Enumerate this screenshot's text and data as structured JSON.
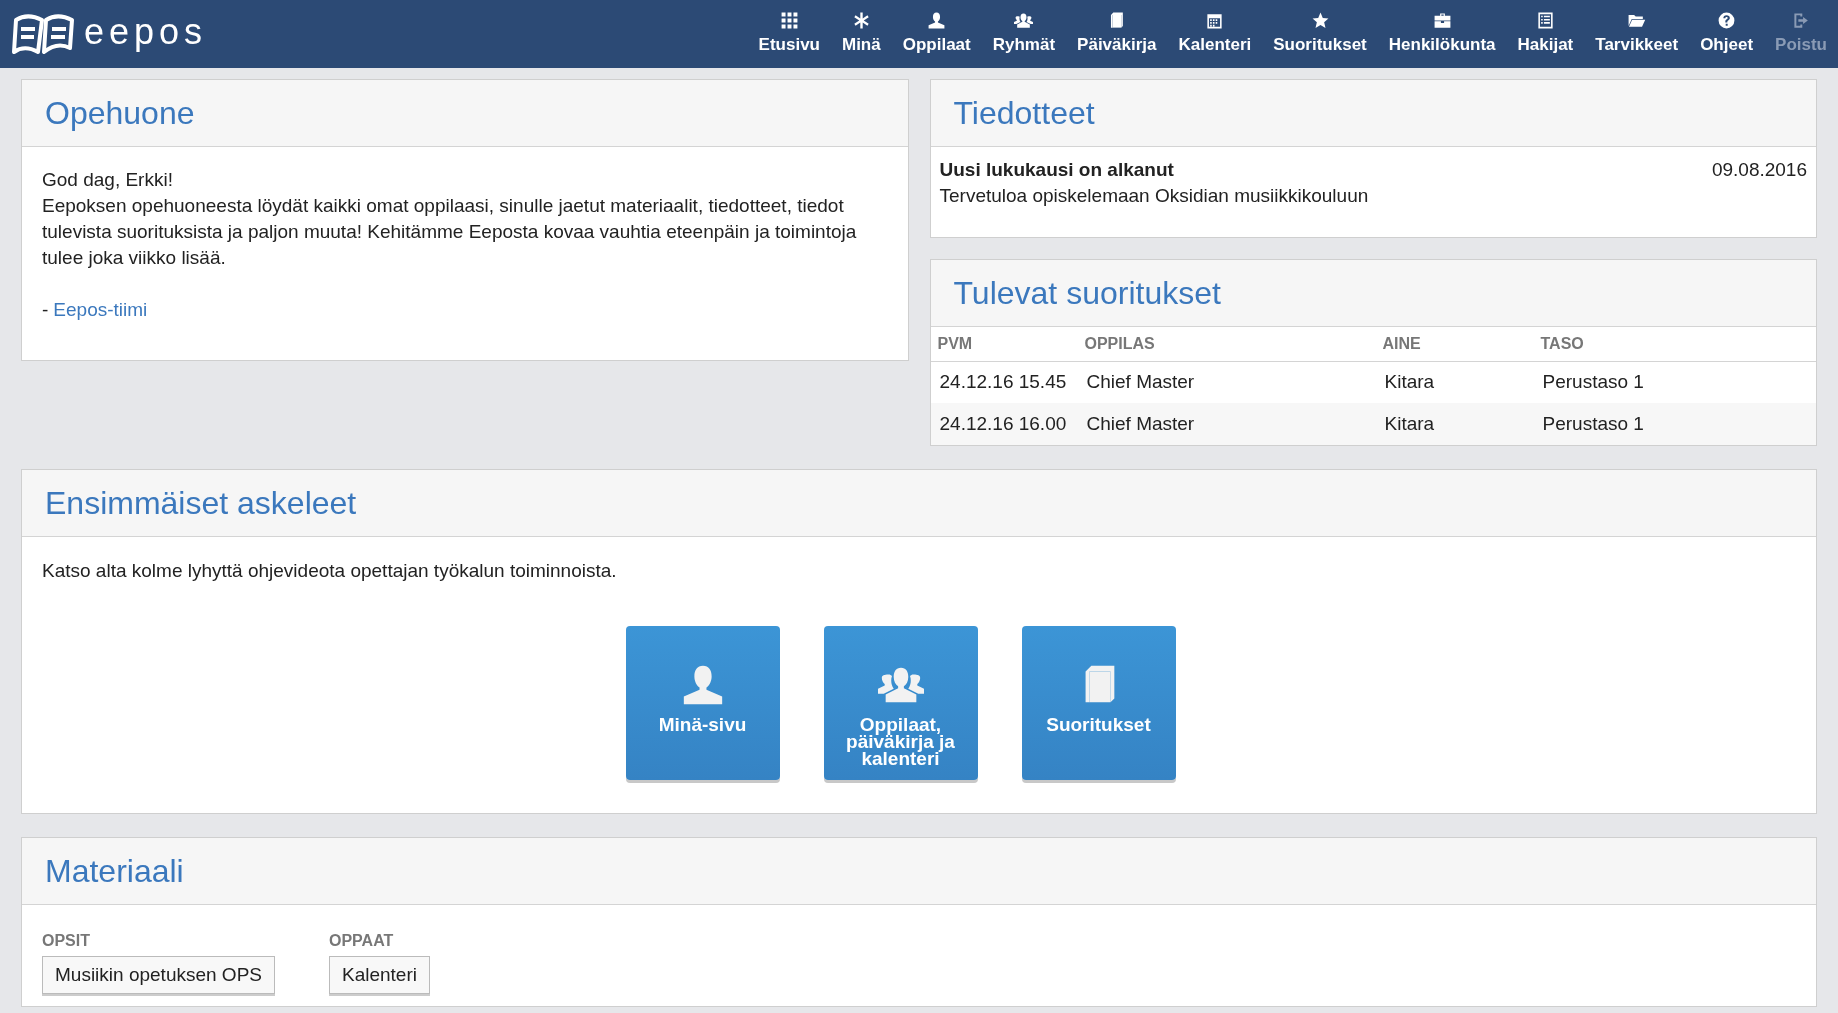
{
  "logo": {
    "text": "eepos"
  },
  "nav": [
    {
      "label": "Etusivu",
      "kind": "grid",
      "disabled": false
    },
    {
      "label": "Minä",
      "kind": "asterisk",
      "disabled": false
    },
    {
      "label": "Oppilaat",
      "kind": "user",
      "disabled": false
    },
    {
      "label": "Ryhmät",
      "kind": "users",
      "disabled": false
    },
    {
      "label": "Päiväkirja",
      "kind": "book",
      "disabled": false
    },
    {
      "label": "Kalenteri",
      "kind": "calendar",
      "disabled": false
    },
    {
      "label": "Suoritukset",
      "kind": "star",
      "disabled": false
    },
    {
      "label": "Henkilökunta",
      "kind": "briefcase",
      "disabled": false
    },
    {
      "label": "Hakijat",
      "kind": "list",
      "disabled": false
    },
    {
      "label": "Tarvikkeet",
      "kind": "folder",
      "disabled": false
    },
    {
      "label": "Ohjeet",
      "kind": "question",
      "disabled": false
    },
    {
      "label": "Poistu",
      "kind": "logout",
      "disabled": true
    }
  ],
  "opehuone": {
    "title": "Opehuone",
    "greeting": "God dag, Erkki!",
    "body": "Eepoksen opehuoneesta löydät kaikki omat oppilaasi, sinulle jaetut materiaalit, tiedotteet, tiedot tulevista suorituksista ja paljon muuta! Kehitämme Eeposta kovaa vauhtia eteenpäin ja toimintoja tulee joka viikko lisää.",
    "signature_prefix": "-",
    "signature_link": "Eepos-tiimi"
  },
  "tiedotteet": {
    "title": "Tiedotteet",
    "items": [
      {
        "title": "Uusi lukukausi on alkanut",
        "date": "09.08.2016",
        "text": "Tervetuloa opiskelemaan Oksidian musiikkikouluun"
      }
    ]
  },
  "tulevat": {
    "title": "Tulevat suoritukset",
    "columns": [
      "PVM",
      "OPPILAS",
      "AINE",
      "TASO"
    ],
    "rows": [
      [
        "24.12.16 15.45",
        "Chief Master",
        "Kitara",
        "Perustaso 1"
      ],
      [
        "24.12.16 16.00",
        "Chief Master",
        "Kitara",
        "Perustaso 1"
      ]
    ]
  },
  "askeleet": {
    "title": "Ensimmäiset askeleet",
    "intro": "Katso alta kolme lyhyttä ohjevideota opettajan työkalun toiminnoista.",
    "tiles": [
      {
        "label": "Minä-sivu",
        "kind": "user"
      },
      {
        "label": "Oppilaat, päiväkirja ja kalenteri",
        "kind": "users"
      },
      {
        "label": "Suoritukset",
        "kind": "book"
      }
    ]
  },
  "materiaali": {
    "title": "Materiaali",
    "groups": [
      {
        "heading": "OPSIT",
        "buttons": [
          "Musiikin opetuksen OPS"
        ]
      },
      {
        "heading": "OPPAAT",
        "buttons": [
          "Kalenteri"
        ]
      }
    ]
  }
}
